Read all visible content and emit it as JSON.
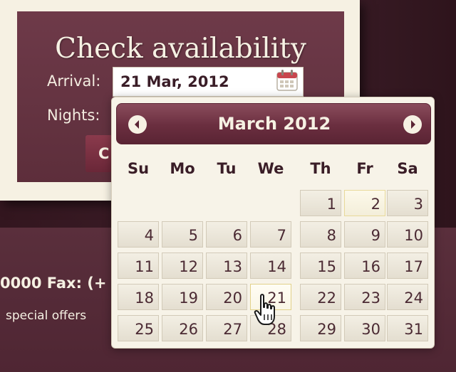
{
  "form": {
    "title": "Check availability",
    "arrival_label": "Arrival:",
    "arrival_value": "21 Mar, 2012",
    "nights_label": "Nights:",
    "check_button_label": "C"
  },
  "footer": {
    "contact": "0000 Fax: (+",
    "offers": "special offers"
  },
  "datepicker": {
    "title": "March 2012",
    "weekdays": [
      "Su",
      "Mo",
      "Tu",
      "We",
      "Th",
      "Fr",
      "Sa"
    ],
    "weeks": [
      [
        "",
        "",
        "",
        "",
        "1",
        "2",
        "3"
      ],
      [
        "4",
        "5",
        "6",
        "7",
        "8",
        "9",
        "10"
      ],
      [
        "11",
        "12",
        "13",
        "14",
        "15",
        "16",
        "17"
      ],
      [
        "18",
        "19",
        "20",
        "21",
        "22",
        "23",
        "24"
      ],
      [
        "25",
        "26",
        "27",
        "28",
        "29",
        "30",
        "31"
      ]
    ],
    "highlighted_day": "2",
    "selected_day": "21"
  },
  "colors": {
    "accent": "#6e3a49",
    "header_gradient_top": "#8a4c5c",
    "background_dark": "#3a1d27",
    "cream": "#f6f1e3"
  },
  "icons": {
    "calendar": "calendar-icon",
    "prev": "prev-month-icon",
    "next": "next-month-icon",
    "cursor": "hand-pointer-icon"
  }
}
